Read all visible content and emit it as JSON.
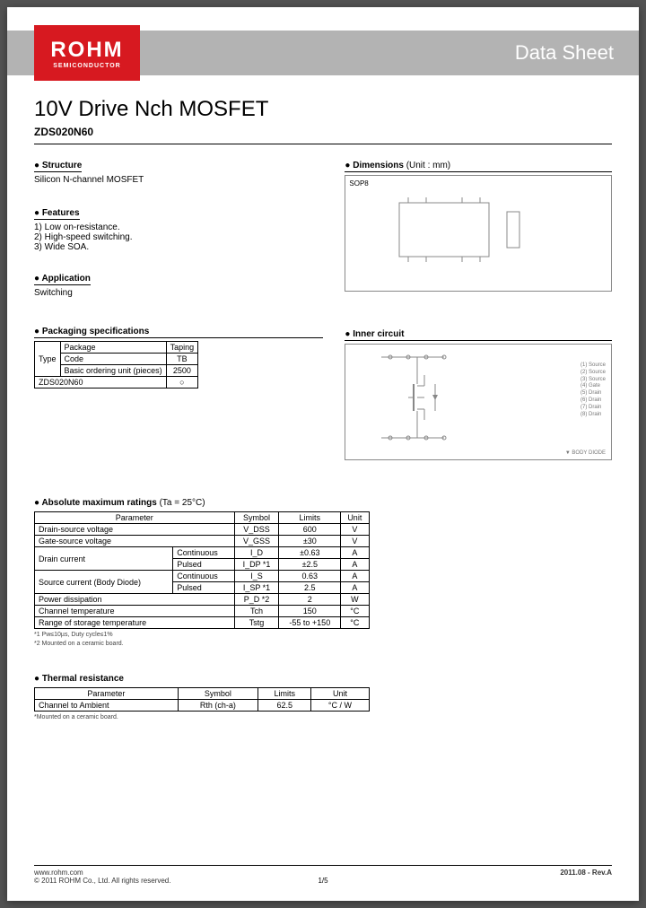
{
  "logo": {
    "brand": "ROHM",
    "tagline": "SEMICONDUCTOR"
  },
  "header": {
    "datasheet": "Data Sheet"
  },
  "title": "10V Drive Nch MOSFET",
  "part_number": "ZDS020N60",
  "sections": {
    "structure": {
      "head": "● Structure",
      "text": "Silicon N-channel MOSFET"
    },
    "features": {
      "head": "● Features",
      "items": [
        "1) Low on-resistance.",
        "2) High-speed switching.",
        "3) Wide SOA."
      ]
    },
    "application": {
      "head": "● Application",
      "text": "Switching"
    },
    "packaging": {
      "head": "● Packaging specifications",
      "row_type": "Type",
      "row_package": "Package",
      "row_code": "Code",
      "row_bou": "Basic ordering unit (pieces)",
      "package_val": "Taping",
      "code_val": "TB",
      "bou_val": "2500",
      "part": "ZDS020N60",
      "mark": "○"
    },
    "dimensions": {
      "head": "● Dimensions",
      "unit": "(Unit : mm)",
      "pkg": "SOP8"
    },
    "inner": {
      "head": "● Inner circuit",
      "pins": [
        "(1) Source",
        "(2) Source",
        "(3) Source",
        "(4) Gate",
        "(5) Drain",
        "(6) Drain",
        "(7) Drain",
        "(8) Drain"
      ],
      "body_diode": "▼ BODY DIODE"
    },
    "amr": {
      "head": "● Absolute maximum ratings",
      "cond": "(Ta = 25°C)",
      "cols": [
        "Parameter",
        "Symbol",
        "Limits",
        "Unit"
      ],
      "rows": [
        {
          "p": "Drain-source voltage",
          "s": "V_DSS",
          "l": "600",
          "u": "V"
        },
        {
          "p": "Gate-source voltage",
          "s": "V_GSS",
          "l": "±30",
          "u": "V"
        },
        {
          "p": "Drain current",
          "sub": "Continuous",
          "s": "I_D",
          "l": "±0.63",
          "u": "A"
        },
        {
          "p": "",
          "sub": "Pulsed",
          "s": "I_DP *1",
          "l": "±2.5",
          "u": "A"
        },
        {
          "p": "Source current (Body Diode)",
          "sub": "Continuous",
          "s": "I_S",
          "l": "0.63",
          "u": "A"
        },
        {
          "p": "",
          "sub": "Pulsed",
          "s": "I_SP *1",
          "l": "2.5",
          "u": "A"
        },
        {
          "p": "Power dissipation",
          "s": "P_D *2",
          "l": "2",
          "u": "W"
        },
        {
          "p": "Channel temperature",
          "s": "Tch",
          "l": "150",
          "u": "°C"
        },
        {
          "p": "Range of storage temperature",
          "s": "Tstg",
          "l": "-55 to +150",
          "u": "°C"
        }
      ],
      "note1": "*1 Pw≤10µs, Duty cycle≤1%",
      "note2": "*2 Mounted on a ceramic board."
    },
    "thermal": {
      "head": "● Thermal resistance",
      "cols": [
        "Parameter",
        "Symbol",
        "Limits",
        "Unit"
      ],
      "row": {
        "p": "Channel to Ambient",
        "s": "Rth (ch-a)",
        "l": "62.5",
        "u": "°C / W"
      },
      "note": "*Mounted on a ceramic board."
    }
  },
  "footer": {
    "url": "www.rohm.com",
    "copyright": "© 2011  ROHM Co., Ltd. All rights reserved.",
    "page": "1/5",
    "rev": "2011.08 -  Rev.A"
  }
}
